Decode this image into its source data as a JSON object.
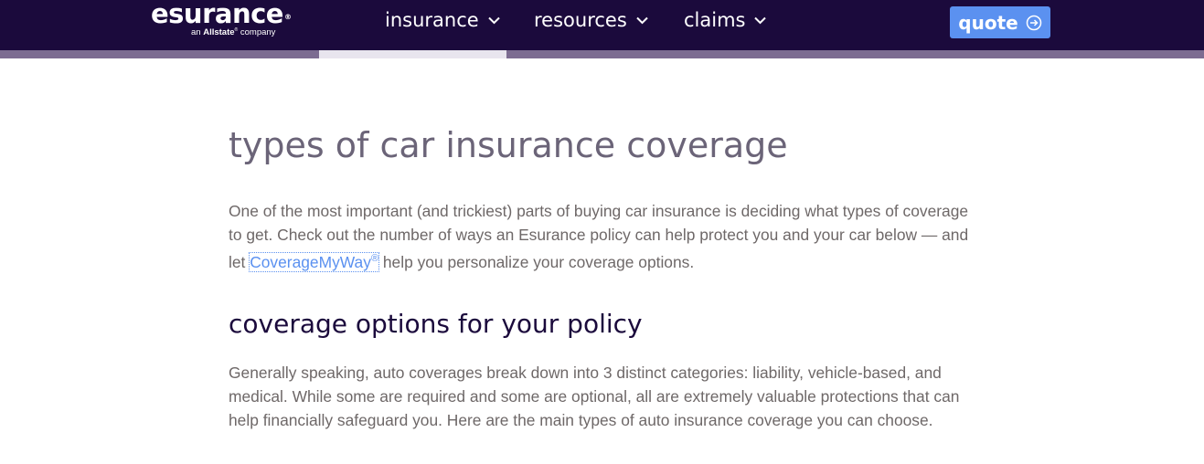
{
  "colors": {
    "header_bg": "#1b0a3c",
    "subbar": "#7c6c91",
    "subbar_active": "#e8e5ee",
    "quote_button": "#5b91f0",
    "link": "#5b91f0",
    "title_text": "#6b6478",
    "heading_text": "#1b0a3c",
    "body_text": "#6e6868"
  },
  "header": {
    "logo": {
      "brand": "esurance",
      "registered": "®",
      "tagline_prefix": "an",
      "tagline_brand": "Allstate",
      "tagline_suffix": "company"
    },
    "nav": [
      {
        "label": "insurance",
        "icon": "chevron-down-icon"
      },
      {
        "label": "resources",
        "icon": "chevron-down-icon"
      },
      {
        "label": "claims",
        "icon": "chevron-down-icon"
      }
    ],
    "quote_button": {
      "label": "quote",
      "icon": "arrow-circle-right-icon"
    }
  },
  "main": {
    "title": "types of car insurance coverage",
    "intro": {
      "before": "One of the most important (and trickiest) parts of buying car insurance is deciding what types of coverage to get. Check out the number of ways an Esurance policy can help protect you and your car below — and let ",
      "link": "CoverageMyWay",
      "link_sup": "®",
      "after": " help you personalize your coverage options."
    },
    "section_heading": "coverage options for your policy",
    "section_body": "Generally speaking, auto coverages break down into 3 distinct categories: liability, vehicle-based, and medical. While some are required and some are optional, all are extremely valuable protections that can help financially safeguard you. Here are the main types of auto insurance coverage you can choose."
  }
}
